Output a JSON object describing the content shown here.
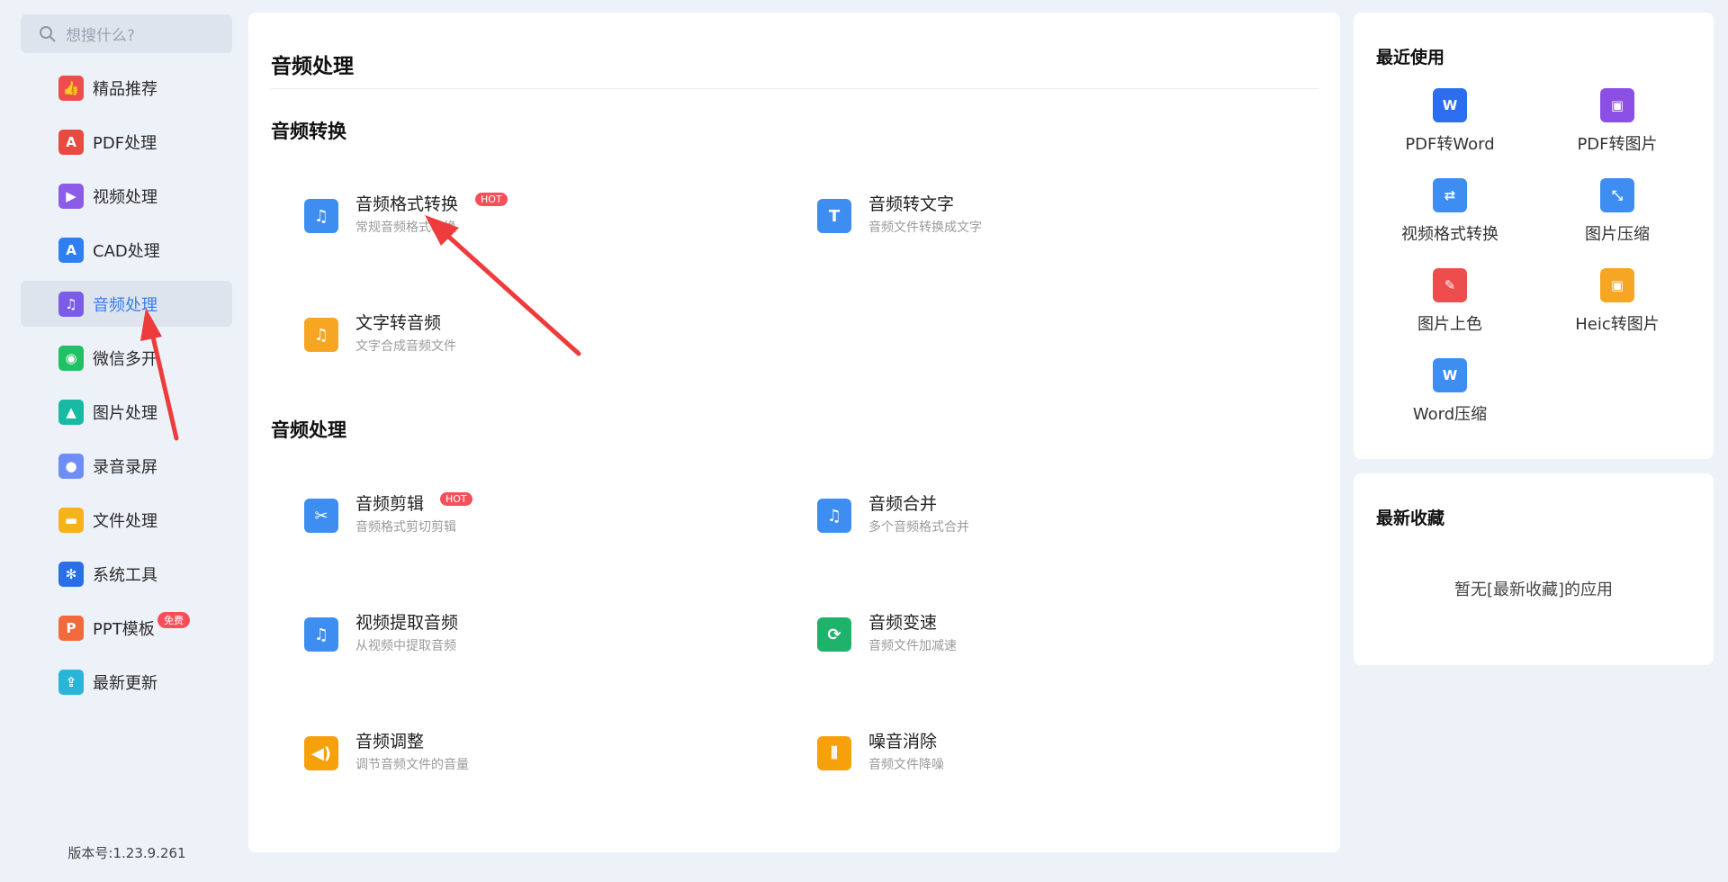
{
  "sidebar": {
    "search_placeholder": "想搜什么?",
    "items": [
      {
        "label": "精品推荐",
        "color": "#ee4d4d",
        "glyph": "👍"
      },
      {
        "label": "PDF处理",
        "color": "#e94a3f",
        "glyph": "A"
      },
      {
        "label": "视频处理",
        "color": "#8c5ce8",
        "glyph": "▶"
      },
      {
        "label": "CAD处理",
        "color": "#2f7ff2",
        "glyph": "A"
      },
      {
        "label": "音频处理",
        "color": "#7b5ce8",
        "glyph": "♫"
      },
      {
        "label": "微信多开",
        "color": "#22c065",
        "glyph": "◉"
      },
      {
        "label": "图片处理",
        "color": "#19b9a3",
        "glyph": "▲"
      },
      {
        "label": "录音录屏",
        "color": "#6f8ef5",
        "glyph": "●"
      },
      {
        "label": "文件处理",
        "color": "#f6b21b",
        "glyph": "▬"
      },
      {
        "label": "系统工具",
        "color": "#2a6fe6",
        "glyph": "✻"
      },
      {
        "label": "PPT模板",
        "color": "#f06a3c",
        "glyph": "P",
        "badge": "免费"
      },
      {
        "label": "最新更新",
        "color": "#28b5d8",
        "glyph": "⇪"
      }
    ],
    "version": "版本号:1.23.9.261"
  },
  "main": {
    "title": "音频处理",
    "sections": [
      {
        "title": "音频转换",
        "tools": [
          {
            "name": "音频格式转换",
            "desc": "常规音频格式转换",
            "hot": "HOT",
            "color": "#3d8ef0",
            "glyph": "♫"
          },
          {
            "name": "音频转文字",
            "desc": "音频文件转换成文字",
            "color": "#3d8ef0",
            "glyph": "T"
          },
          {
            "name": "文字转音频",
            "desc": "文字合成音频文件",
            "color": "#f6a623",
            "glyph": "♫"
          }
        ]
      },
      {
        "title": "音频处理",
        "tools": [
          {
            "name": "音频剪辑",
            "desc": "音频格式剪切剪辑",
            "hot": "HOT",
            "color": "#3d8ef0",
            "glyph": "✂"
          },
          {
            "name": "音频合并",
            "desc": "多个音频格式合并",
            "color": "#3d8ef0",
            "glyph": "♫"
          },
          {
            "name": "视频提取音频",
            "desc": "从视频中提取音频",
            "color": "#3d8ef0",
            "glyph": "♫"
          },
          {
            "name": "音频变速",
            "desc": "音频文件加减速",
            "color": "#1fb26b",
            "glyph": "⟳"
          },
          {
            "name": "音频调整",
            "desc": "调节音频文件的音量",
            "color": "#f6a10b",
            "glyph": "◀)"
          },
          {
            "name": "噪音消除",
            "desc": "音频文件降噪",
            "color": "#f6a10b",
            "glyph": "⦀"
          }
        ]
      }
    ]
  },
  "recent": {
    "title": "最近使用",
    "items": [
      {
        "label": "PDF转Word",
        "color": "#2d6ef0",
        "glyph": "W"
      },
      {
        "label": "PDF转图片",
        "color": "#8b4fe6",
        "glyph": "▣"
      },
      {
        "label": "视频格式转换",
        "color": "#3d8ef0",
        "glyph": "⇄"
      },
      {
        "label": "图片压缩",
        "color": "#3d8ef0",
        "glyph": "⤡"
      },
      {
        "label": "图片上色",
        "color": "#ee4d4d",
        "glyph": "✎"
      },
      {
        "label": "Heic转图片",
        "color": "#f6a623",
        "glyph": "▣"
      },
      {
        "label": "Word压缩",
        "color": "#3d8ef0",
        "glyph": "W"
      }
    ]
  },
  "favorites": {
    "title": "最新收藏",
    "empty_text": "暂无[最新收藏]的应用"
  },
  "annotation_color": "#ee3b3b"
}
